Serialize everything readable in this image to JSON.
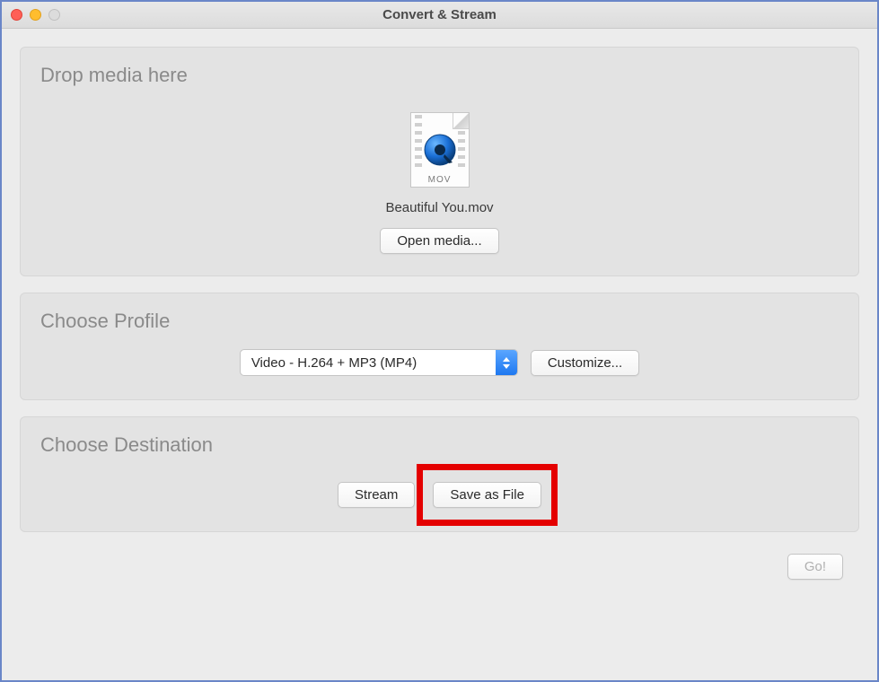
{
  "window": {
    "title": "Convert & Stream"
  },
  "drop_panel": {
    "heading": "Drop media here",
    "file_format_label": "MOV",
    "filename": "Beautiful You.mov",
    "open_media_label": "Open media..."
  },
  "profile_panel": {
    "heading": "Choose Profile",
    "selected_profile": "Video - H.264 + MP3 (MP4)",
    "customize_label": "Customize..."
  },
  "destination_panel": {
    "heading": "Choose Destination",
    "stream_label": "Stream",
    "save_as_file_label": "Save as File"
  },
  "go_button_label": "Go!"
}
